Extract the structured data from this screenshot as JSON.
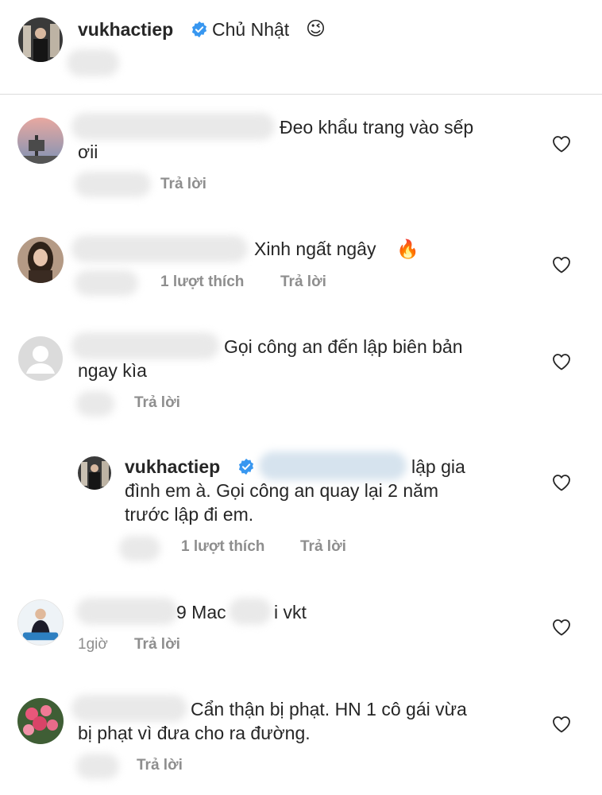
{
  "post": {
    "username": "vukhactiep",
    "caption": "Chủ Nhật",
    "caption_emoji": "😉"
  },
  "comments": [
    {
      "text_line1": "Đeo khẩu trang vào sếp",
      "text_line2": "ơii",
      "reply_label": "Trả lời"
    },
    {
      "text_line1": "Xinh ngất ngây",
      "emoji": "🔥",
      "likes_label": "1 lượt thích",
      "reply_label": "Trả lời"
    },
    {
      "text_line1": "Gọi công an đến lập biên bản",
      "text_line2": "ngay kìa",
      "reply_label": "Trả lời"
    },
    {
      "username": "vukhactiep",
      "text_line1": "lập gia",
      "text_line2": "đình em à. Gọi công an quay lại 2 năm",
      "text_line3": "trước lập đi em.",
      "likes_label": "1 lượt thích",
      "reply_label": "Trả lời"
    },
    {
      "text_fragment1": "9 Mac",
      "text_fragment2": "i vkt",
      "time": "1giờ",
      "reply_label": "Trả lời"
    },
    {
      "text_line1": "Cẩn thận bị phạt. HN 1 cô gái vừa",
      "text_line2": "bị phạt vì đưa cho ra đường.",
      "reply_label": "Trả lời"
    }
  ],
  "colors": {
    "text": "#262626",
    "meta": "#8e8e8e",
    "verified": "#3897f0",
    "divider": "#dbdbdb"
  },
  "icons": [
    "verified-badge-icon",
    "heart-outline-icon"
  ]
}
